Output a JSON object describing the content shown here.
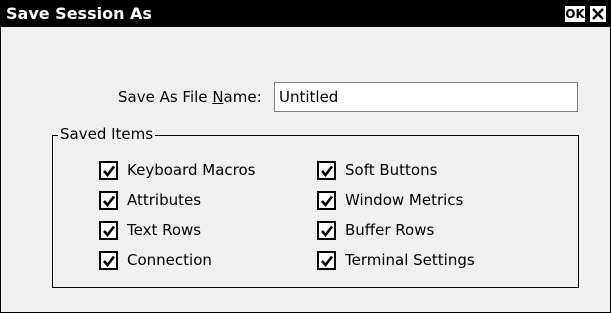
{
  "window": {
    "title": "Save Session As",
    "ok_button": "OK",
    "close_icon": "close-icon"
  },
  "file_name": {
    "label_prefix": "Save As File ",
    "label_mnemonic": "N",
    "label_suffix": "ame:",
    "value": "Untitled"
  },
  "saved_items": {
    "legend": "Saved Items",
    "left": [
      {
        "label": "Keyboard Macros",
        "checked": true
      },
      {
        "label": "Attributes",
        "checked": true
      },
      {
        "label": "Text Rows",
        "checked": true
      },
      {
        "label": "Connection",
        "checked": true
      }
    ],
    "right": [
      {
        "label": "Soft Buttons",
        "checked": true
      },
      {
        "label": "Window Metrics",
        "checked": true
      },
      {
        "label": "Buffer Rows",
        "checked": true
      },
      {
        "label": "Terminal Settings",
        "checked": true
      }
    ]
  }
}
